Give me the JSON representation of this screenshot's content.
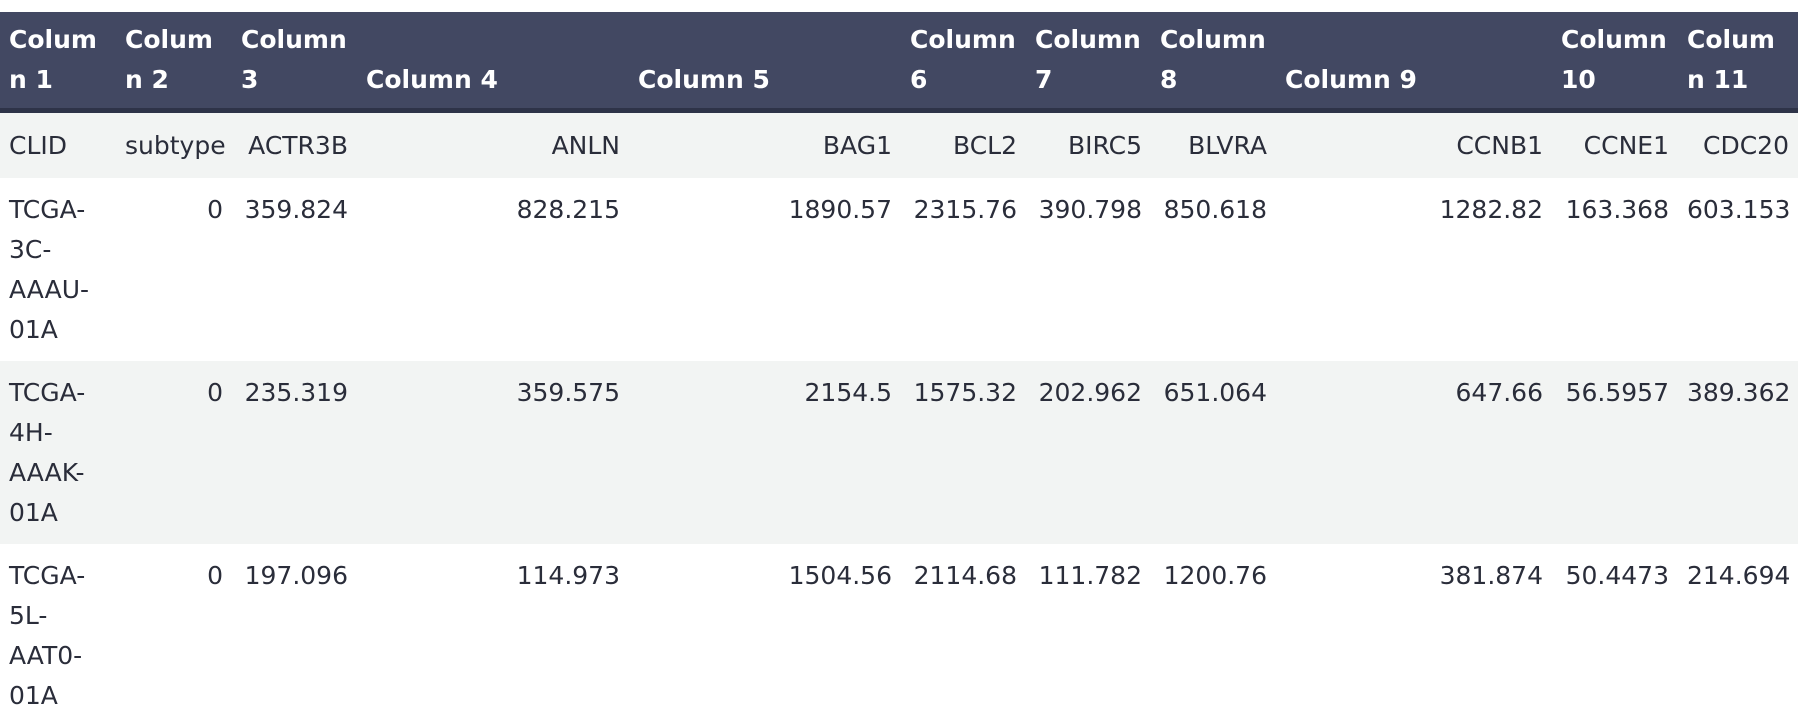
{
  "table": {
    "headers": [
      "Column 1",
      "Column 2",
      "Column 3",
      "Column 4",
      "Column 5",
      "Column 6",
      "Column 7",
      "Column 8",
      "Column 9",
      "Column 10",
      "Column 11"
    ],
    "rows": [
      [
        "CLID",
        "subtype",
        "ACTR3B",
        "ANLN",
        "BAG1",
        "BCL2",
        "BIRC5",
        "BLVRA",
        "",
        "CCNB1",
        "CCNE1",
        "CDC20"
      ],
      [
        "TCGA-3C-AAAU-01A",
        "0",
        "359.824",
        "828.215",
        "1890.57",
        "2315.76",
        "390.798",
        "850.618",
        "",
        "1282.82",
        "163.368",
        "603.153"
      ],
      [
        "TCGA-4H-AAAK-01A",
        "0",
        "235.319",
        "359.575",
        "2154.5",
        "1575.32",
        "202.962",
        "651.064",
        "",
        "647.66",
        "56.5957",
        "389.362"
      ],
      [
        "TCGA-5L-AAT0-01A",
        "0",
        "197.096",
        "114.973",
        "1504.56",
        "2114.68",
        "111.782",
        "1200.76",
        "",
        "381.874",
        "50.4473",
        "214.694"
      ]
    ]
  }
}
